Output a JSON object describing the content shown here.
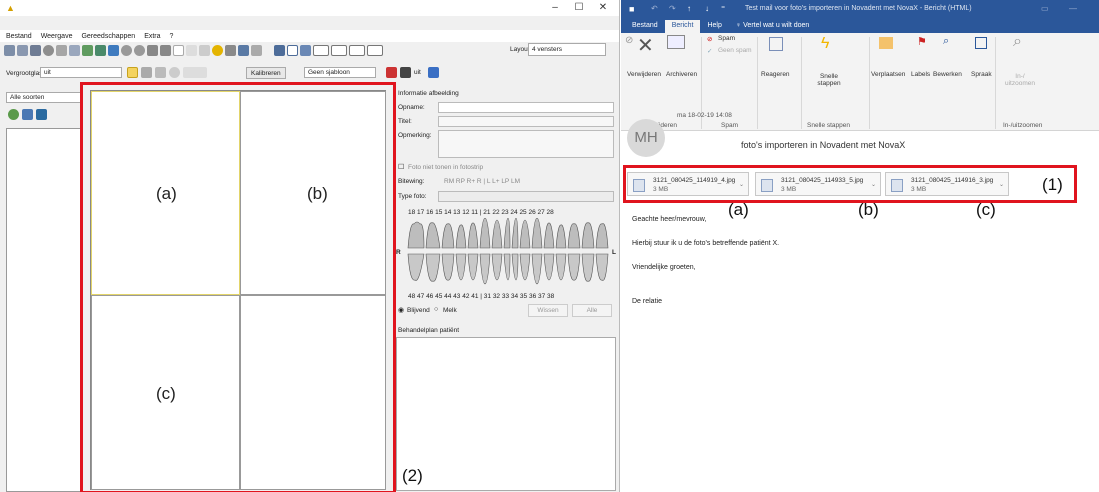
{
  "left_app": {
    "menu": [
      "Bestand",
      "Weergave",
      "Gereedschappen",
      "Extra",
      "?"
    ],
    "window_controls": [
      "–",
      "☐",
      "✕"
    ],
    "layout_label": "Layout:",
    "layout_value": "4 vensters",
    "vergrootglas_label": "Vergrootglas:",
    "vergrootglas_value": "uit",
    "kalibreren": "Kalibreren",
    "sjabloon": "Geen sjabloon",
    "uit_label": "uit",
    "filter_value": "Alle soorten",
    "info": {
      "heading": "Informatie afbeelding",
      "opname": "Opname:",
      "titel": "Titel:",
      "opmerking": "Opmerking:",
      "fotostrip": "Foto niet tonen in fotostrip",
      "bitewing": "Bitewing:",
      "bitewing_opts": "RM  RP  R+  R  |  L  L+  LP  LM",
      "type_foto": "Type foto:",
      "upper_teeth": "18 17 16 15 14 13 12 11 | 21 22 23 24 25 26 27 28",
      "lower_teeth": "48 47 46 45 44 43 42 41 | 31 32 33 34 35 36 37 38",
      "side_r": "R",
      "side_l": "L",
      "blijvend": "Blijvend",
      "melk": "Melk",
      "wissen": "Wissen",
      "alle": "Alle",
      "plan_heading": "Behandelplan patiënt"
    }
  },
  "annotations": {
    "a": "(a)",
    "b": "(b)",
    "c": "(c)",
    "one": "(1)",
    "two": "(2)"
  },
  "outlook": {
    "title": "Test mail voor foto's importeren in Novadent met NovaX  -  Bericht (HTML)",
    "tabs": [
      "Bestand",
      "Bericht",
      "Help",
      "Vertel wat u wilt doen"
    ],
    "ribbon": {
      "verwijderen": "Verwijderen",
      "archiveren": "Archiveren",
      "spam": "Spam",
      "geen_spam": "Geen spam",
      "reageren": "Reageren",
      "snelle_stappen": "Snelle stappen",
      "verplaatsen": "Verplaatsen",
      "labels": "Labels",
      "bewerken": "Bewerken",
      "spraak": "Spraak",
      "inuitzoomen": "In-/ uitzoomen",
      "group_verwijderen": "Verwijderen",
      "group_spam": "Spam",
      "group_snelle": "Snelle stappen",
      "group_zoom": "In-/uitzoomen"
    },
    "avatar_initials": "MH",
    "date": "ma 18-02-19 14:08",
    "subject": "foto's importeren in Novadent met NovaX",
    "attachments": [
      {
        "name": "3121_080425_114919_4.jpg",
        "size": "3 MB"
      },
      {
        "name": "3121_080425_114933_5.jpg",
        "size": "3 MB"
      },
      {
        "name": "3121_080425_114916_3.jpg",
        "size": "3 MB"
      }
    ],
    "body": [
      "Geachte heer/mevrouw,",
      "Hierbij stuur ik u de foto's betreffende patiënt X.",
      "Vriendelijke groeten,",
      "De relatie"
    ]
  },
  "colors": {
    "highlight_red": "#e0141e",
    "outlook_blue": "#2b579a",
    "selected_cell": "#e3d56a"
  }
}
